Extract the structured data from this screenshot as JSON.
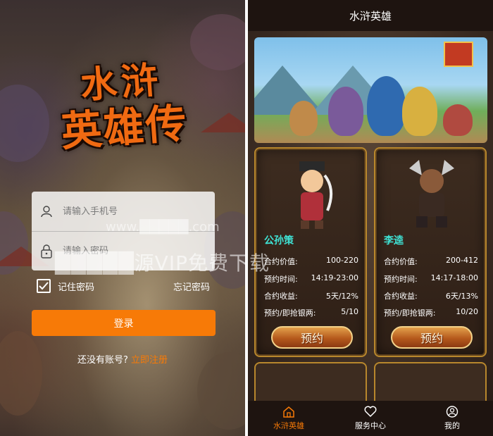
{
  "login": {
    "logo_line1": "水浒",
    "logo_line2": "英雄传",
    "phone_placeholder": "请输入手机号",
    "password_placeholder": "请输入密码",
    "remember_label": "记住密码",
    "forgot_label": "忘记密码",
    "login_button": "登录",
    "no_account_text": "还没有账号?",
    "register_link": "立即注册"
  },
  "watermark": {
    "line1": "www.█████.com",
    "line2": "█████源VIP免费下载"
  },
  "app": {
    "title": "水浒英雄",
    "cards": [
      {
        "name": "公孙策",
        "rows": [
          {
            "label": "合约价值:",
            "value": "100-220"
          },
          {
            "label": "预约时间:",
            "value": "14:19-23:00"
          },
          {
            "label": "合约收益:",
            "value": "5天/12%"
          },
          {
            "label": "预约/即抢银两:",
            "value": "5/10"
          }
        ],
        "button": "预约"
      },
      {
        "name": "李逵",
        "rows": [
          {
            "label": "合约价值:",
            "value": "200-412"
          },
          {
            "label": "预约时间:",
            "value": "14:17-18:00"
          },
          {
            "label": "合约收益:",
            "value": "6天/13%"
          },
          {
            "label": "预约/即抢银两:",
            "value": "10/20"
          }
        ],
        "button": "预约"
      }
    ],
    "tabs": [
      {
        "label": "水浒英雄",
        "icon": "home-icon",
        "active": true
      },
      {
        "label": "服务中心",
        "icon": "heart-icon",
        "active": false
      },
      {
        "label": "我的",
        "icon": "user-icon",
        "active": false
      }
    ],
    "accent_color": "#f77a07",
    "name_color": "#3fe4d6"
  }
}
